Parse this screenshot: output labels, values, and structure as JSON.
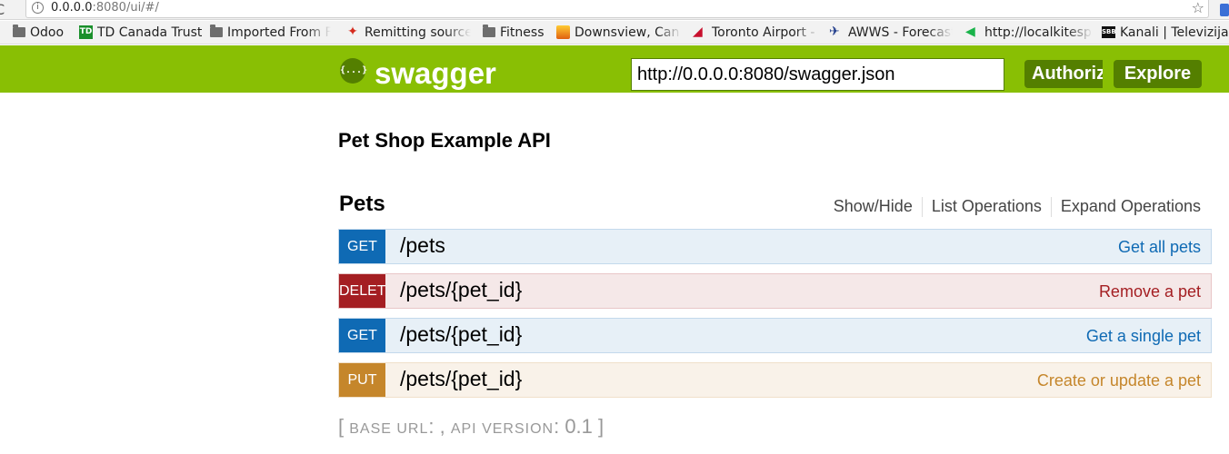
{
  "browser": {
    "url_host": "0.0.0.0",
    "url_rest": ":8080/ui/#/",
    "bookmarks": [
      {
        "label": "Odoo",
        "icon": "folder-icon"
      },
      {
        "label": "TD Canada Trust",
        "icon": "td-icon",
        "badge": "TD"
      },
      {
        "label": "Imported From Fi",
        "icon": "folder-icon"
      },
      {
        "label": "Remitting source",
        "icon": "maple-leaf-icon"
      },
      {
        "label": "Fitness",
        "icon": "folder-icon"
      },
      {
        "label": "Downsview, Can",
        "icon": "weather-icon"
      },
      {
        "label": "Toronto Airport -",
        "icon": "airline-icon"
      },
      {
        "label": "AWWS - Forecast",
        "icon": "awws-icon"
      },
      {
        "label": "http://localkitesp",
        "icon": "kite-icon"
      },
      {
        "label": "Kanali | Televizija",
        "icon": "sbb-icon",
        "badge": "SBB"
      }
    ]
  },
  "header": {
    "logo_glyph": "{...}",
    "logo_text": "swagger",
    "api_url": "http://0.0.0.0:8080/swagger.json",
    "authorize_label": "Authorize",
    "explore_label": "Explore",
    "colors": {
      "bar": "#89bf04",
      "button": "#547f00"
    }
  },
  "info": {
    "title": "Pet Shop Example API"
  },
  "resource": {
    "name": "Pets",
    "links": [
      "Show/Hide",
      "List Operations",
      "Expand Operations"
    ],
    "operations": [
      {
        "method": "GET",
        "path": "/pets",
        "summary": "Get all pets"
      },
      {
        "method": "DELETE",
        "path": "/pets/{pet_id}",
        "summary": "Remove a pet"
      },
      {
        "method": "GET",
        "path": "/pets/{pet_id}",
        "summary": "Get a single pet"
      },
      {
        "method": "PUT",
        "path": "/pets/{pet_id}",
        "summary": "Create or update a pet"
      }
    ]
  },
  "footer": {
    "open": "[ ",
    "base_url_label": "BASE URL",
    "base_url_sep": ": , ",
    "api_version_label": "API VERSION",
    "api_version_sep": ": ",
    "api_version": "0.1",
    "close": " ]"
  },
  "method_colors": {
    "GET": "#0f6ab4",
    "DELETE": "#a41e22",
    "PUT": "#c5862b"
  }
}
